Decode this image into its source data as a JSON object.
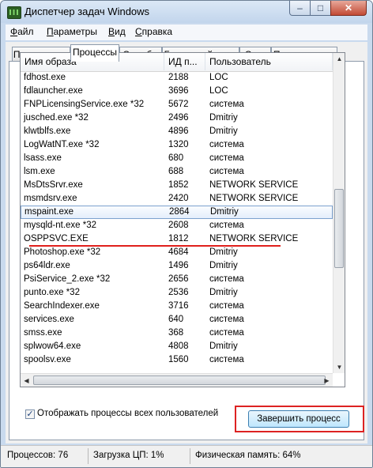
{
  "window": {
    "title": "Диспетчер задач Windows",
    "caption": {
      "minimize": "–",
      "maximize": "□",
      "close": "✕"
    }
  },
  "menu": [
    {
      "label_first": "Ф",
      "label_rest": "айл"
    },
    {
      "label_first": "П",
      "label_rest": "араметры"
    },
    {
      "label_first": "В",
      "label_rest": "ид"
    },
    {
      "label_first": "С",
      "label_rest": "правка"
    }
  ],
  "tabs": [
    "Приложения",
    "Процессы",
    "Службы",
    "Быстродействие",
    "Сеть",
    "Пользователи"
  ],
  "active_tab": "Процессы",
  "columns": {
    "image_name": "Имя образа",
    "pid": "ИД п...",
    "user": "Пользователь"
  },
  "processes": [
    {
      "name": "fdhost.exe",
      "pid": "2188",
      "user": "LOC"
    },
    {
      "name": "fdlauncher.exe",
      "pid": "3696",
      "user": "LOC"
    },
    {
      "name": "FNPLicensingService.exe *32",
      "pid": "5672",
      "user": "система"
    },
    {
      "name": "jusched.exe *32",
      "pid": "2496",
      "user": "Dmitriy"
    },
    {
      "name": "klwtblfs.exe",
      "pid": "4896",
      "user": "Dmitriy"
    },
    {
      "name": "LogWatNT.exe *32",
      "pid": "1320",
      "user": "система"
    },
    {
      "name": "lsass.exe",
      "pid": "680",
      "user": "система"
    },
    {
      "name": "lsm.exe",
      "pid": "688",
      "user": "система"
    },
    {
      "name": "MsDtsSrvr.exe",
      "pid": "1852",
      "user": "NETWORK SERVICE"
    },
    {
      "name": "msmdsrv.exe",
      "pid": "2420",
      "user": "NETWORK SERVICE"
    },
    {
      "name": "mspaint.exe",
      "pid": "2864",
      "user": "Dmitriy",
      "selected": true
    },
    {
      "name": "mysqld-nt.exe *32",
      "pid": "2608",
      "user": "система"
    },
    {
      "name": "OSPPSVC.EXE",
      "pid": "1812",
      "user": "NETWORK SERVICE"
    },
    {
      "name": "Photoshop.exe *32",
      "pid": "4684",
      "user": "Dmitriy"
    },
    {
      "name": "ps64ldr.exe",
      "pid": "1496",
      "user": "Dmitriy"
    },
    {
      "name": "PsiService_2.exe *32",
      "pid": "2656",
      "user": "система"
    },
    {
      "name": "punto.exe *32",
      "pid": "2536",
      "user": "Dmitriy"
    },
    {
      "name": "SearchIndexer.exe",
      "pid": "3716",
      "user": "система"
    },
    {
      "name": "services.exe",
      "pid": "640",
      "user": "система"
    },
    {
      "name": "smss.exe",
      "pid": "368",
      "user": "система"
    },
    {
      "name": "splwow64.exe",
      "pid": "4808",
      "user": "Dmitriy"
    },
    {
      "name": "spoolsv.exe",
      "pid": "1560",
      "user": "система"
    }
  ],
  "show_all_users": {
    "label": "Отображать процессы всех пользователей",
    "checked": true
  },
  "end_process_button": "Завершить процесс",
  "status": {
    "processes": "Процессов: 76",
    "cpu": "Загрузка ЦП: 1%",
    "memory": "Физическая память: 64%"
  },
  "colors": {
    "highlight_annotation": "#e0201c",
    "selection_border": "#7da2ce"
  }
}
